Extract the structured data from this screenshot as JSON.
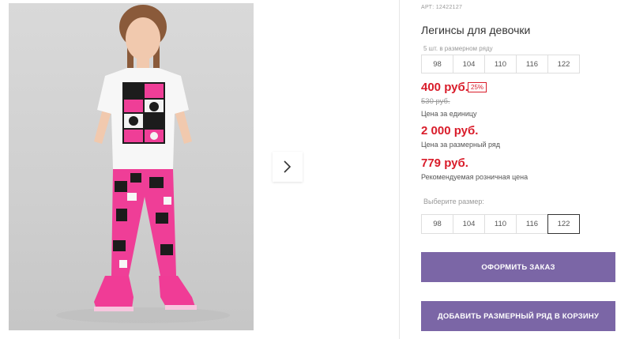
{
  "product": {
    "article": "АРТ: 12422127",
    "title": "Легинсы для девочки",
    "row_label": "5 шт. в размерном ряду",
    "row_sizes": [
      "98",
      "104",
      "110",
      "116",
      "122"
    ],
    "price": "400 руб.",
    "discount": "25%",
    "old_price": "530 руб.",
    "unit_price_label": "Цена за единицу",
    "row_price": "2 000 руб.",
    "row_price_label": "Цена за размерный ряд",
    "recommended_price": "779 руб.",
    "recommended_price_label": "Рекомендуемая розничная цена",
    "choose_size_label": "Выберите размер:",
    "sizes": [
      "98",
      "104",
      "110",
      "116",
      "122"
    ],
    "selected_size": "122"
  },
  "buttons": {
    "order": "ОФОРМИТЬ ЗАКАЗ",
    "add_row": "ДОБАВИТЬ РАЗМЕРНЫЙ РЯД В КОРЗИНУ"
  },
  "gallery": {
    "next_icon": "chevron-right-icon"
  },
  "colors": {
    "accent": "#7b66a6",
    "price": "#d91c2a"
  }
}
